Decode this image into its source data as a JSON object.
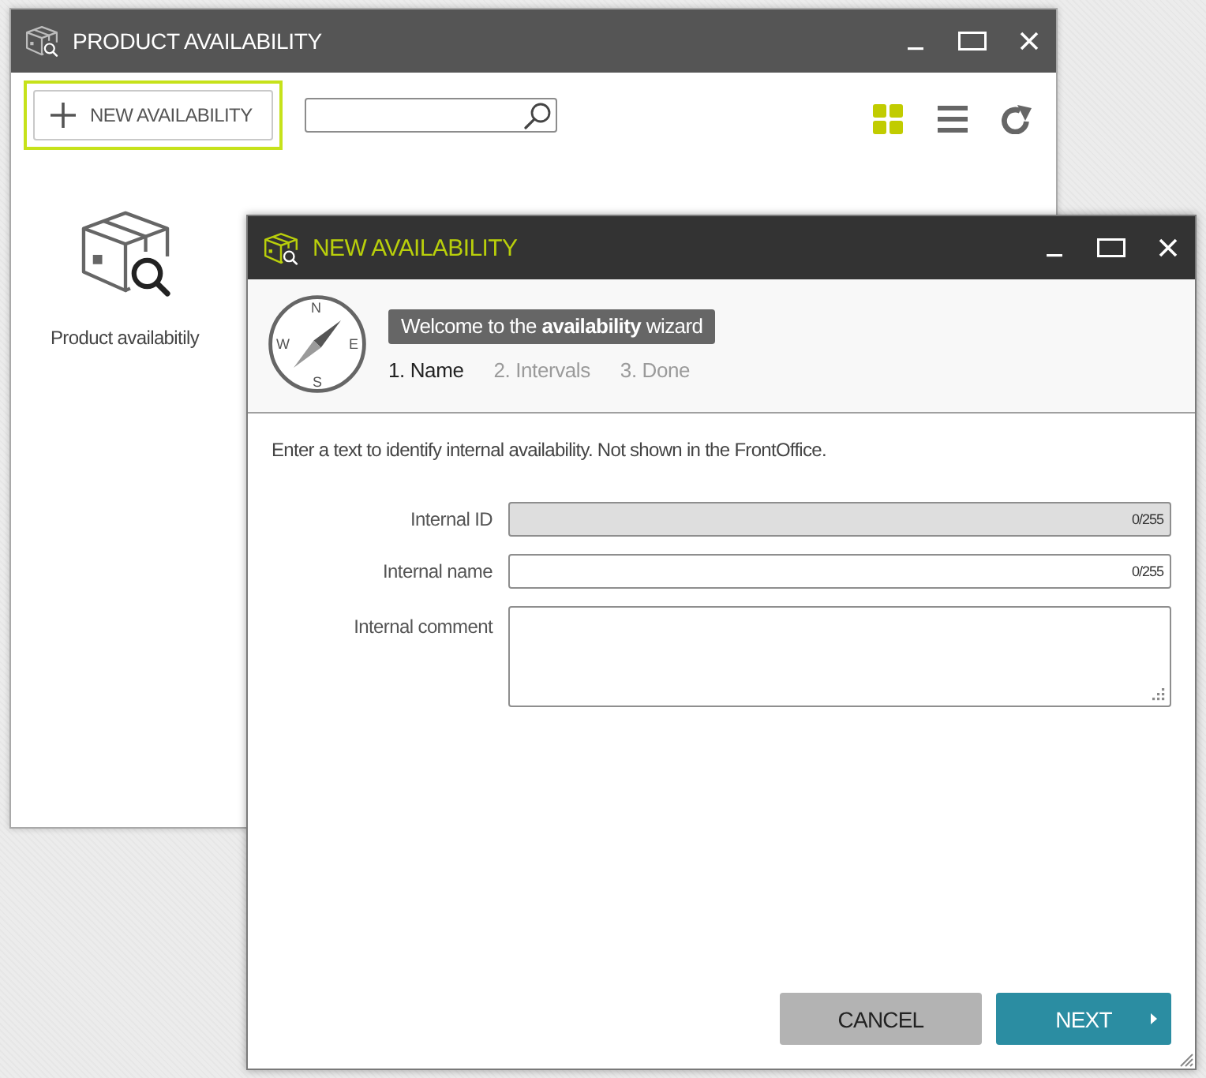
{
  "main_window": {
    "title": "PRODUCT AVAILABILITY",
    "toolbar": {
      "new_button": {
        "label": "NEW AVAILABILITY",
        "focused": true
      },
      "view_modes": [
        {
          "kind": "grid",
          "selected": true
        },
        {
          "kind": "list",
          "selected": false
        }
      ]
    },
    "items": [
      {
        "label": "Product availabitily"
      }
    ]
  },
  "dialog": {
    "title": "NEW AVAILABILITY",
    "compass": {
      "points": [
        "N",
        "E",
        "S",
        "W"
      ]
    },
    "welcome": "Welcome to the **availability** wizard",
    "steps": [
      {
        "label": "1. Name",
        "selected": true
      },
      {
        "label": "2. Intervals",
        "selected": false
      },
      {
        "label": "3. Done",
        "selected": false
      }
    ],
    "instruction": "Enter a text to identify internal availability. Not shown in the FrontOffice.",
    "fields": [
      {
        "kind": "input",
        "label": "Internal ID",
        "disabled": true,
        "counter": "0/255"
      },
      {
        "kind": "input",
        "label": "Internal name",
        "disabled": false,
        "counter": "0/255"
      },
      {
        "kind": "textarea",
        "label": "Internal comment",
        "disabled": false
      }
    ],
    "buttons": [
      {
        "kind": "secondary",
        "label": "CANCEL"
      },
      {
        "kind": "primary",
        "label": "NEXT"
      }
    ]
  }
}
